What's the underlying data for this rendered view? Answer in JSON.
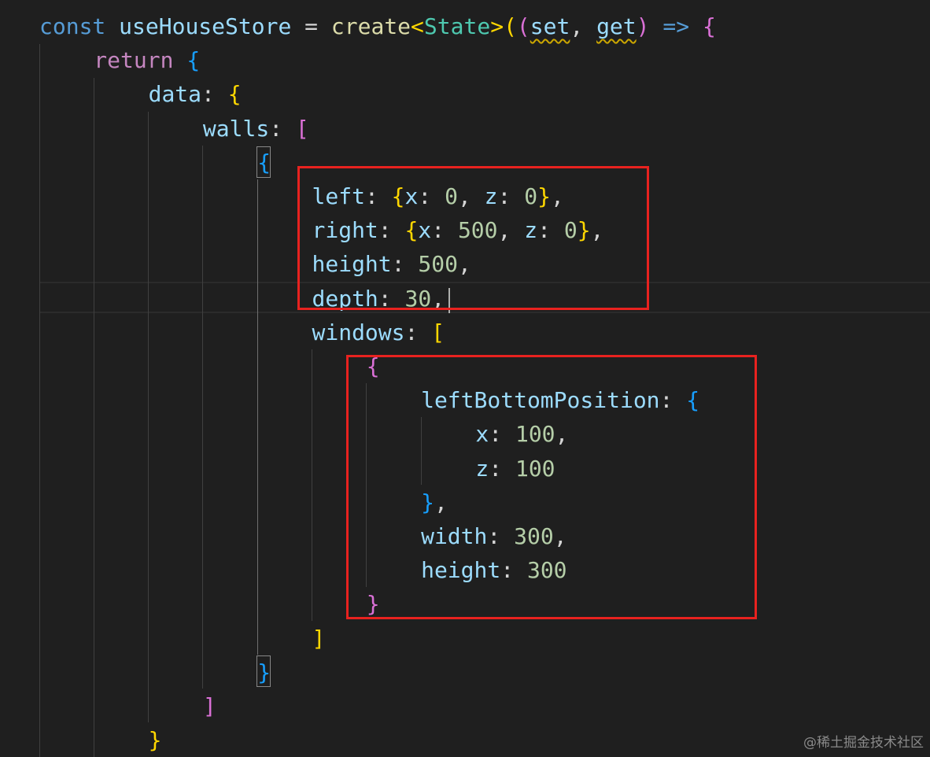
{
  "code": {
    "lines": [
      {
        "tokens": [
          {
            "t": "const ",
            "c": "kw-blue"
          },
          {
            "t": "useHouseStore",
            "c": "param"
          },
          {
            "t": " = ",
            "c": "punc"
          },
          {
            "t": "create",
            "c": "fn"
          },
          {
            "t": "<",
            "c": "br-gold"
          },
          {
            "t": "State",
            "c": "type"
          },
          {
            "t": ">",
            "c": "br-gold"
          },
          {
            "t": "(",
            "c": "br-gold"
          },
          {
            "t": "(",
            "c": "br-pink"
          },
          {
            "t": "set",
            "c": "param squiggle"
          },
          {
            "t": ", ",
            "c": "punc"
          },
          {
            "t": "get",
            "c": "param squiggle"
          },
          {
            "t": ")",
            "c": "br-pink"
          },
          {
            "t": " => ",
            "c": "kw-blue"
          },
          {
            "t": "{",
            "c": "br-pink"
          }
        ]
      },
      {
        "tokens": [
          {
            "t": "return ",
            "c": "kw-purple"
          },
          {
            "t": "{",
            "c": "br-blue"
          }
        ]
      },
      {
        "tokens": [
          {
            "t": "data",
            "c": "prop"
          },
          {
            "t": ": ",
            "c": "punc"
          },
          {
            "t": "{",
            "c": "br-gold"
          }
        ]
      },
      {
        "tokens": [
          {
            "t": "walls",
            "c": "prop"
          },
          {
            "t": ": ",
            "c": "punc"
          },
          {
            "t": "[",
            "c": "br-pink"
          }
        ]
      },
      {
        "tokens": [
          {
            "t": "{",
            "c": "br-blue"
          }
        ]
      },
      {
        "tokens": [
          {
            "t": "left",
            "c": "prop"
          },
          {
            "t": ": ",
            "c": "punc"
          },
          {
            "t": "{",
            "c": "br-gold"
          },
          {
            "t": "x",
            "c": "prop"
          },
          {
            "t": ": ",
            "c": "punc"
          },
          {
            "t": "0",
            "c": "num"
          },
          {
            "t": ", ",
            "c": "punc"
          },
          {
            "t": "z",
            "c": "prop"
          },
          {
            "t": ": ",
            "c": "punc"
          },
          {
            "t": "0",
            "c": "num"
          },
          {
            "t": "}",
            "c": "br-gold"
          },
          {
            "t": ",",
            "c": "punc"
          }
        ]
      },
      {
        "tokens": [
          {
            "t": "right",
            "c": "prop"
          },
          {
            "t": ": ",
            "c": "punc"
          },
          {
            "t": "{",
            "c": "br-gold"
          },
          {
            "t": "x",
            "c": "prop"
          },
          {
            "t": ": ",
            "c": "punc"
          },
          {
            "t": "500",
            "c": "num"
          },
          {
            "t": ", ",
            "c": "punc"
          },
          {
            "t": "z",
            "c": "prop"
          },
          {
            "t": ": ",
            "c": "punc"
          },
          {
            "t": "0",
            "c": "num"
          },
          {
            "t": "}",
            "c": "br-gold"
          },
          {
            "t": ",",
            "c": "punc"
          }
        ]
      },
      {
        "tokens": [
          {
            "t": "height",
            "c": "prop"
          },
          {
            "t": ": ",
            "c": "punc"
          },
          {
            "t": "500",
            "c": "num"
          },
          {
            "t": ",",
            "c": "punc"
          }
        ]
      },
      {
        "tokens": [
          {
            "t": "depth",
            "c": "prop"
          },
          {
            "t": ": ",
            "c": "punc"
          },
          {
            "t": "30",
            "c": "num"
          },
          {
            "t": ",",
            "c": "punc"
          }
        ]
      },
      {
        "tokens": [
          {
            "t": "windows",
            "c": "prop"
          },
          {
            "t": ": ",
            "c": "punc"
          },
          {
            "t": "[",
            "c": "br-gold"
          }
        ]
      },
      {
        "tokens": [
          {
            "t": "{",
            "c": "br-pink"
          }
        ]
      },
      {
        "tokens": [
          {
            "t": "leftBottomPosition",
            "c": "prop"
          },
          {
            "t": ": ",
            "c": "punc"
          },
          {
            "t": "{",
            "c": "br-blue"
          }
        ]
      },
      {
        "tokens": [
          {
            "t": "x",
            "c": "prop"
          },
          {
            "t": ": ",
            "c": "punc"
          },
          {
            "t": "100",
            "c": "num"
          },
          {
            "t": ",",
            "c": "punc"
          }
        ]
      },
      {
        "tokens": [
          {
            "t": "z",
            "c": "prop"
          },
          {
            "t": ": ",
            "c": "punc"
          },
          {
            "t": "100",
            "c": "num"
          }
        ]
      },
      {
        "tokens": [
          {
            "t": "}",
            "c": "br-blue"
          },
          {
            "t": ",",
            "c": "punc"
          }
        ]
      },
      {
        "tokens": [
          {
            "t": "width",
            "c": "prop"
          },
          {
            "t": ": ",
            "c": "punc"
          },
          {
            "t": "300",
            "c": "num"
          },
          {
            "t": ",",
            "c": "punc"
          }
        ]
      },
      {
        "tokens": [
          {
            "t": "height",
            "c": "prop"
          },
          {
            "t": ": ",
            "c": "punc"
          },
          {
            "t": "300",
            "c": "num"
          }
        ]
      },
      {
        "tokens": [
          {
            "t": "}",
            "c": "br-pink"
          }
        ]
      },
      {
        "tokens": [
          {
            "t": "]",
            "c": "br-gold"
          }
        ]
      },
      {
        "tokens": [
          {
            "t": "}",
            "c": "br-blue"
          }
        ]
      },
      {
        "tokens": [
          {
            "t": "]",
            "c": "br-pink"
          }
        ]
      },
      {
        "tokens": [
          {
            "t": "}",
            "c": "br-gold"
          }
        ]
      }
    ]
  },
  "watermark": "@稀土掘金技术社区",
  "colors": {
    "background": "#1f1f1f",
    "highlight_box": "#e8221f"
  }
}
